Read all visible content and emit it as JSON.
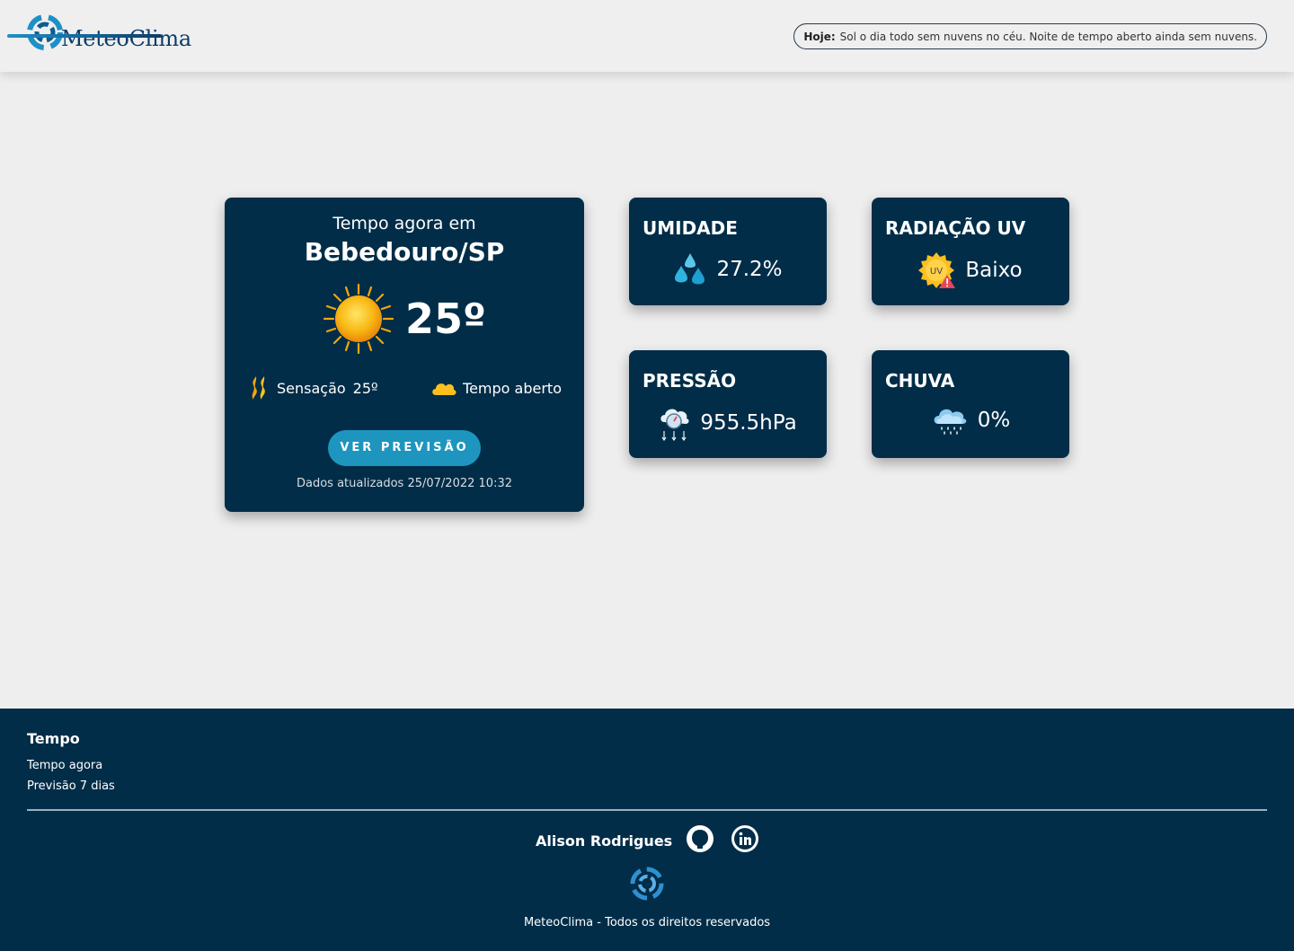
{
  "header": {
    "logo_text": "MeteoClima",
    "today_label": "Hoje:",
    "today_text": "Sol o dia todo sem nuvens no céu. Noite de tempo aberto ainda sem nuvens."
  },
  "current": {
    "subtitle": "Tempo agora em",
    "city": "Bebedouro/SP",
    "temperature": "25º",
    "feels_label": "Sensação",
    "feels_value": "25º",
    "condition": "Tempo aberto",
    "button": "VER PREVISÃO",
    "updated": "Dados atualizados 25/07/2022 10:32"
  },
  "stats": {
    "humidity": {
      "title": "UMIDADE",
      "value": "27.2%"
    },
    "uv": {
      "title": "RADIAÇÃO UV",
      "value": "Baixo",
      "badge": "UV"
    },
    "pressure": {
      "title": "PRESSÃO",
      "value": "955.5hPa"
    },
    "rain": {
      "title": "CHUVA",
      "value": "0%"
    }
  },
  "footer": {
    "section_title": "Tempo",
    "links": [
      "Tempo agora",
      "Previsão 7 dias"
    ],
    "author": "Alison Rodrigues",
    "copyright": "MeteoClima - Todos os direitos reservados"
  },
  "colors": {
    "card_bg": "#012d48",
    "button_bg": "#1e95bf",
    "page_bg": "#eeeeee"
  }
}
